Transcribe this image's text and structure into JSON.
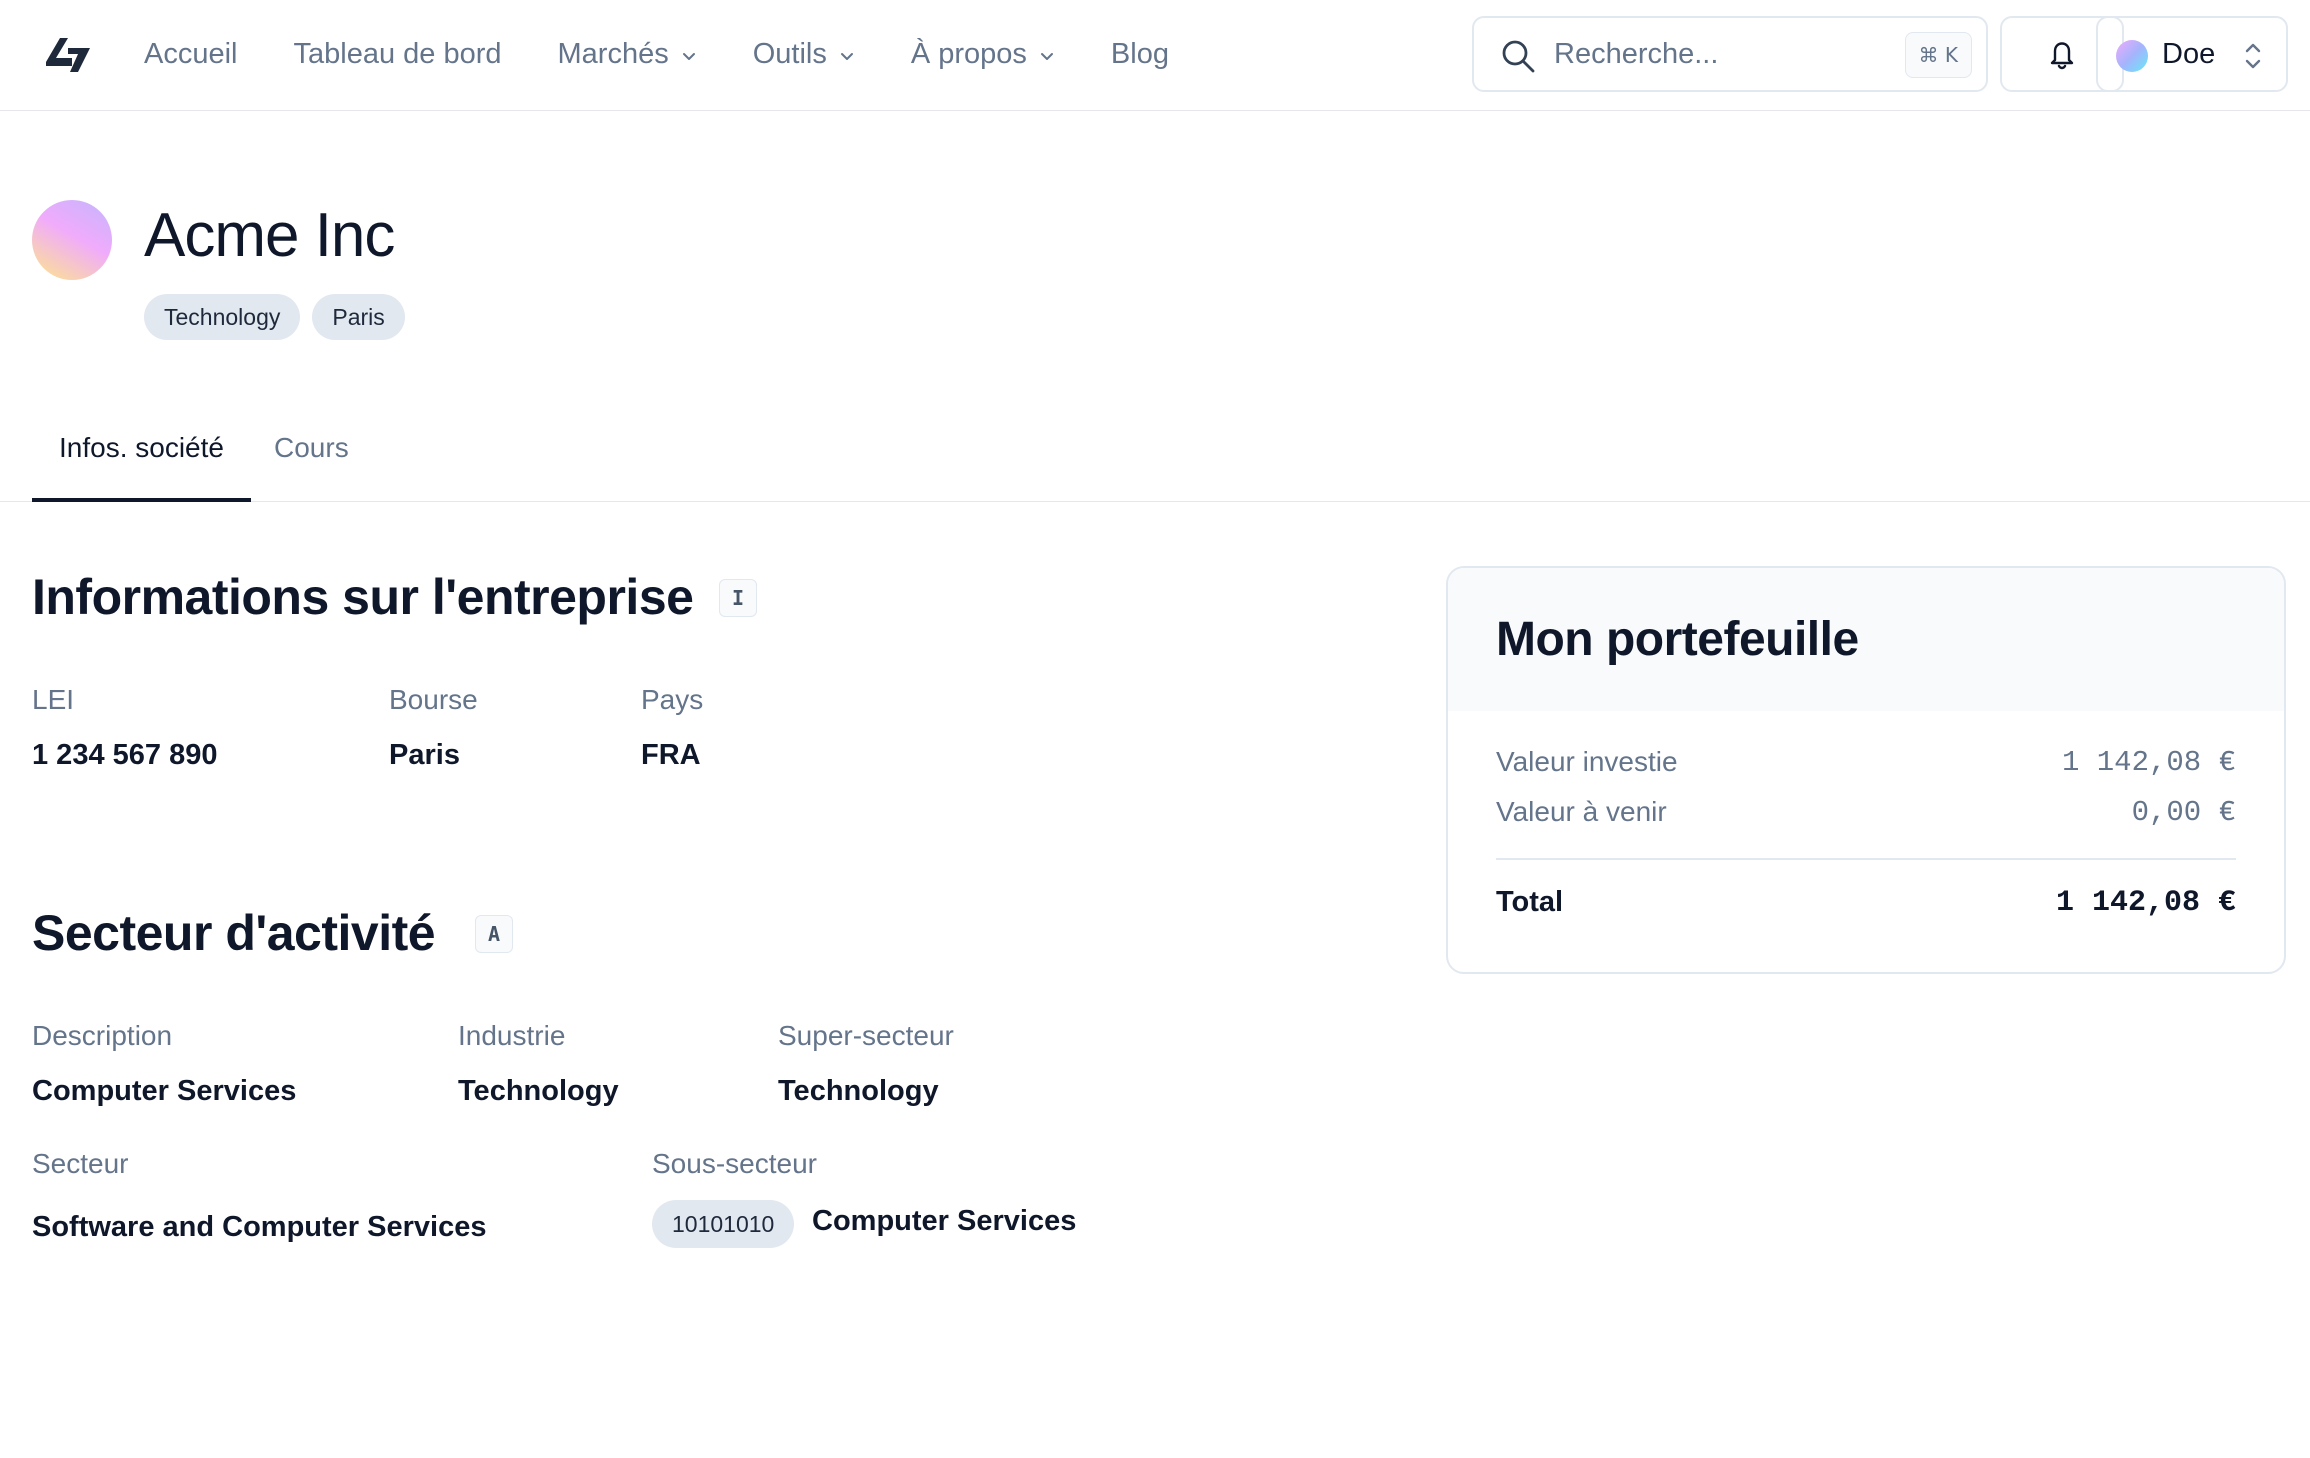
{
  "nav": {
    "items": [
      {
        "label": "Accueil",
        "dropdown": false
      },
      {
        "label": "Tableau de bord",
        "dropdown": false
      },
      {
        "label": "Marchés",
        "dropdown": true
      },
      {
        "label": "Outils",
        "dropdown": true
      },
      {
        "label": "À propos",
        "dropdown": true
      },
      {
        "label": "Blog",
        "dropdown": false
      }
    ],
    "search": {
      "placeholder": "Recherche...",
      "shortcut": "⌘ K"
    },
    "user": {
      "name": "Doe"
    }
  },
  "company": {
    "name": "Acme Inc",
    "tags": [
      "Technology",
      "Paris"
    ]
  },
  "tabs": [
    {
      "label": "Infos. société",
      "active": true
    },
    {
      "label": "Cours",
      "active": false
    }
  ],
  "info": {
    "title": "Informations sur l'entreprise",
    "badge": "I",
    "fields": {
      "lei": {
        "label": "LEI",
        "value": "1 234 567 890"
      },
      "bourse": {
        "label": "Bourse",
        "value": "Paris"
      },
      "pays": {
        "label": "Pays",
        "value": "FRA"
      }
    }
  },
  "sector": {
    "title": "Secteur d'activité",
    "badge": "A",
    "fields": {
      "description": {
        "label": "Description",
        "value": "Computer Services"
      },
      "industrie": {
        "label": "Industrie",
        "value": "Technology"
      },
      "super_secteur": {
        "label": "Super-secteur",
        "value": "Technology"
      },
      "secteur": {
        "label": "Secteur",
        "value": "Software and Computer Services"
      },
      "sous_secteur": {
        "label": "Sous-secteur",
        "code": "10101010",
        "value": "Computer Services"
      }
    }
  },
  "portfolio": {
    "title": "Mon portefeuille",
    "rows": [
      {
        "label": "Valeur investie",
        "value": "1 142,08 €"
      },
      {
        "label": "Valeur à venir",
        "value": "0,00 €"
      }
    ],
    "total": {
      "label": "Total",
      "value": "1 142,08 €"
    }
  },
  "colors": {
    "text_primary": "#0f172a",
    "text_muted": "#64748b",
    "border": "#e2e8f0",
    "chip_bg": "#e2e8f0"
  }
}
